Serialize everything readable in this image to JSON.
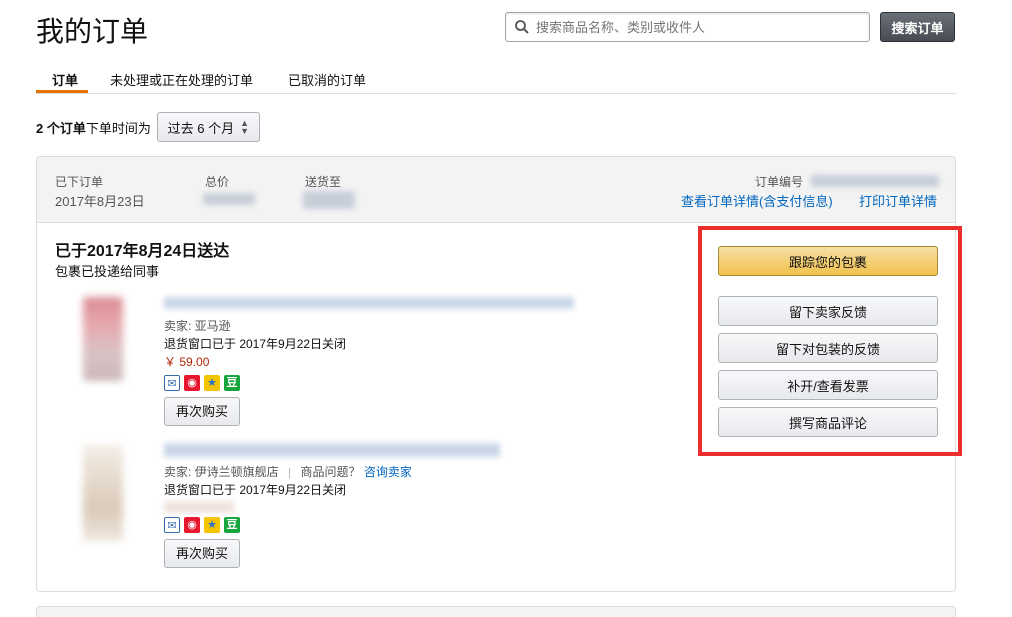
{
  "page_title": "我的订单",
  "search": {
    "placeholder": "搜索商品名称、类别或收件人",
    "button_label": "搜索订单"
  },
  "tabs": [
    {
      "label": "订单",
      "active": true
    },
    {
      "label": "未处理或正在处理的订单",
      "active": false
    },
    {
      "label": "已取消的订单",
      "active": false
    }
  ],
  "filter": {
    "count_text": "2 个订单",
    "label": "下单时间为",
    "period_value": "过去 6 个月"
  },
  "order": {
    "placed_label": "已下订单",
    "placed_value": "2017年8月23日",
    "total_label": "总价",
    "ship_to_label": "送货至",
    "order_number_label": "订单编号",
    "view_details_link": "查看订单详情(含支付信息)",
    "print_details_link": "打印订单详情",
    "delivery_title": "已于2017年8月24日送达",
    "delivery_subtitle": "包裹已投递给同事",
    "items": [
      {
        "seller_label": "卖家: 亚马逊",
        "return_window": "退货窗口已于 2017年9月22日关闭",
        "price": "￥ 59.00",
        "buy_again_label": "再次购买"
      },
      {
        "seller_label": "卖家: 伊诗兰顿旗舰店",
        "question_label": "商品问题？",
        "contact_seller_link": "咨询卖家",
        "return_window": "退货窗口已于 2017年9月22日关闭",
        "buy_again_label": "再次购买"
      }
    ],
    "actions": {
      "track_package": "跟踪您的包裹",
      "seller_feedback": "留下卖家反馈",
      "package_feedback": "留下对包装的反馈",
      "invoice": "补开/查看发票",
      "write_review": "撰写商品评论"
    },
    "share_icons": [
      "mail-icon",
      "weibo-icon",
      "qzone-icon",
      "douban-icon"
    ],
    "douban_glyph": "豆"
  },
  "colors": {
    "accent_tab": "#e77600",
    "link": "#0066c0",
    "price": "#b12704",
    "primary_button": "#f0c14b",
    "highlight": "#ec2d2d"
  }
}
